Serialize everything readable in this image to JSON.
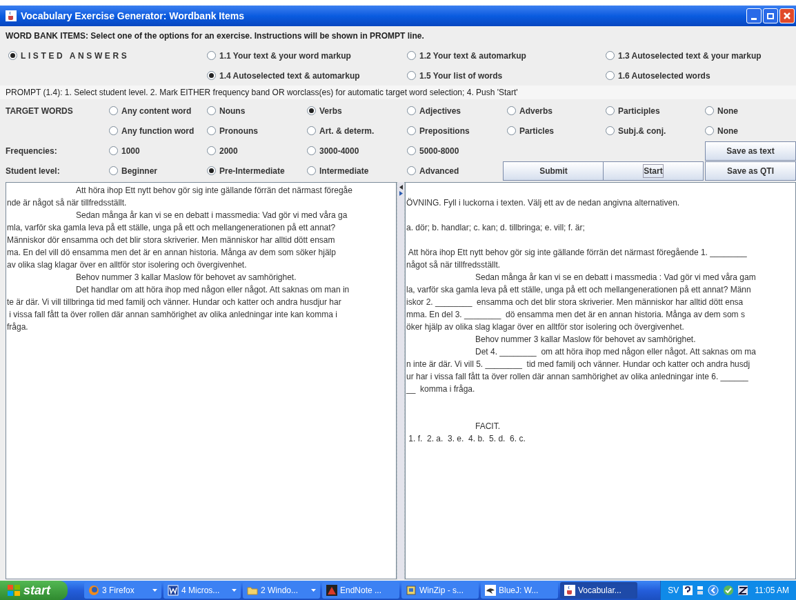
{
  "window": {
    "title": "Vocabulary Exercise Generator: Wordbank Items"
  },
  "header": "WORD BANK ITEMS: Select one of the options for an exercise. Instructions will be shown in PROMPT line.",
  "answer_mode": {
    "label": "LISTED ANSWERS",
    "selected": true
  },
  "exercise_types": [
    {
      "label": "1.1 Your text & your word markup",
      "selected": false
    },
    {
      "label": "1.2 Your text & automarkup",
      "selected": false
    },
    {
      "label": "1.3 Autoselected text & your markup",
      "selected": false
    },
    {
      "label": "1.4 Autoselected text & automarkup",
      "selected": true
    },
    {
      "label": "1.5 Your list of words",
      "selected": false
    },
    {
      "label": "1.6 Autoselected words",
      "selected": false
    }
  ],
  "prompt": "PROMPT (1.4): 1. Select student level. 2. Mark EITHER frequency band OR worclass(es) for automatic target word selection; 4. Push 'Start'",
  "target_words": {
    "label": "TARGET WORDS",
    "rows": [
      [
        {
          "label": "Any content word",
          "selected": false
        },
        {
          "label": "Nouns",
          "selected": false
        },
        {
          "label": "Verbs",
          "selected": true
        },
        {
          "label": "Adjectives",
          "selected": false
        },
        {
          "label": "Adverbs",
          "selected": false
        },
        {
          "label": "Participles",
          "selected": false
        },
        {
          "label": "None",
          "selected": false
        }
      ],
      [
        {
          "label": "Any function word",
          "selected": false
        },
        {
          "label": "Pronouns",
          "selected": false
        },
        {
          "label": "Art. & determ.",
          "selected": false
        },
        {
          "label": "Prepositions",
          "selected": false
        },
        {
          "label": "Particles",
          "selected": false
        },
        {
          "label": "Subj.& conj.",
          "selected": false
        },
        {
          "label": "None",
          "selected": false
        }
      ]
    ]
  },
  "frequencies": {
    "label": "Frequencies:",
    "options": [
      {
        "label": "1000",
        "selected": false
      },
      {
        "label": "2000",
        "selected": false
      },
      {
        "label": "3000-4000",
        "selected": false
      },
      {
        "label": "5000-8000",
        "selected": false
      }
    ]
  },
  "student_level": {
    "label": "Student level:",
    "options": [
      {
        "label": "Beginner",
        "selected": false
      },
      {
        "label": "Pre-Intermediate",
        "selected": true
      },
      {
        "label": "Intermediate",
        "selected": false
      },
      {
        "label": "Advanced",
        "selected": false
      }
    ]
  },
  "buttons": {
    "save_text": {
      "label": "Save as text",
      "focused": false
    },
    "submit": {
      "label": "Submit",
      "focused": false
    },
    "start": {
      "label": "Start",
      "focused": true
    },
    "save_qti": {
      "label": "Save as QTI",
      "focused": false
    }
  },
  "source_text": {
    "lines": [
      {
        "kind": "text",
        "text": "\tAtt höra ihop Ett nytt behov gör sig inte gällande förrän det närmast föregåe"
      },
      {
        "kind": "text",
        "text": "nde är något så när tillfredsställt."
      },
      {
        "kind": "text",
        "text": "\tSedan många år kan vi se en debatt i massmedia: Vad gör vi med våra ga"
      },
      {
        "kind": "text",
        "text": "mla, varför ska gamla leva på ett ställe, unga på ett och mellangenerationen på ett annat?"
      },
      {
        "kind": "text",
        "text": "Människor dör ensamma och det blir stora skriverier. Men människor har alltid dött ensam"
      },
      {
        "kind": "text",
        "text": "ma. En del vill dö ensamma men det är en annan historia. Många av dem som söker hjälp"
      },
      {
        "kind": "text",
        "text": "av olika slag klagar över en alltför stor isolering och övergivenhet."
      },
      {
        "kind": "text",
        "text": "\tBehov nummer 3 kallar Maslow för behovet av samhörighet."
      },
      {
        "kind": "text",
        "text": "\tDet handlar om att höra ihop med någon eller något. Att saknas om man in"
      },
      {
        "kind": "text",
        "text": "te är där. Vi vill tillbringa tid med familj och vänner. Hundar och katter och andra husdjur har"
      },
      {
        "kind": "text",
        "text": " i vissa fall fått ta över rollen där annan samhörighet av olika anledningar inte kan komma i"
      },
      {
        "kind": "text",
        "text": "fråga."
      }
    ]
  },
  "exercise_text": {
    "lines": [
      {
        "kind": "blank"
      },
      {
        "kind": "text",
        "text": "ÖVNING. Fyll i luckorna i texten. Välj ett av de nedan angivna alternativen."
      },
      {
        "kind": "blank"
      },
      {
        "kind": "text",
        "text": "a. dör; b. handlar; c. kan; d. tillbringa; e. vill; f. är;"
      },
      {
        "kind": "blank"
      },
      {
        "kind": "text",
        "text": " Att höra ihop Ett nytt behov gör sig inte gällande förrän det närmast föregående 1. ________"
      },
      {
        "kind": "text",
        "text": "något så när tillfredsställt."
      },
      {
        "kind": "text",
        "text": "\tSedan många år kan vi se en debatt i massmedia : Vad gör vi med våra gam"
      },
      {
        "kind": "text",
        "text": "la, varför ska gamla leva på ett ställe, unga på ett och mellangenerationen på ett annat? Männ"
      },
      {
        "kind": "text",
        "text": "iskor 2. ________  ensamma och det blir stora skriverier. Men människor har alltid dött ensa"
      },
      {
        "kind": "text",
        "text": "mma. En del 3. ________  dö ensamma men det är en annan historia. Många av dem som s"
      },
      {
        "kind": "text",
        "text": "öker hjälp av olika slag klagar över en alltför stor isolering och övergivenhet."
      },
      {
        "kind": "text",
        "text": "\tBehov nummer 3 kallar Maslow för behovet av samhörighet."
      },
      {
        "kind": "text",
        "text": "\tDet 4. ________  om att höra ihop med någon eller något. Att saknas om ma"
      },
      {
        "kind": "text",
        "text": "n inte är där. Vi vill 5. ________  tid med familj och vänner. Hundar och katter och andra husdj"
      },
      {
        "kind": "text",
        "text": "ur har i vissa fall fått ta över rollen där annan samhörighet av olika anledningar inte 6. ______"
      },
      {
        "kind": "text",
        "text": "__  komma i fråga."
      },
      {
        "kind": "blank"
      },
      {
        "kind": "blank"
      },
      {
        "kind": "text",
        "text": "\tFACIT."
      },
      {
        "kind": "text",
        "text": " 1. f.  2. a.  3. e.  4. b.  5. d.  6. c."
      }
    ]
  },
  "taskbar": {
    "start": "start",
    "tasks": [
      {
        "label": "3 Firefox",
        "grouped": true,
        "selected": false
      },
      {
        "label": "4 Micros...",
        "grouped": true,
        "selected": false
      },
      {
        "label": "2 Windo...",
        "grouped": true,
        "selected": false
      },
      {
        "label": "EndNote ...",
        "grouped": false,
        "selected": false
      },
      {
        "label": "WinZip - s...",
        "grouped": false,
        "selected": false
      },
      {
        "label": "BlueJ:  W...",
        "grouped": false,
        "selected": false
      },
      {
        "label": "Vocabular...",
        "grouped": false,
        "selected": true
      }
    ],
    "language": "SV",
    "clock": "11:05 AM"
  }
}
